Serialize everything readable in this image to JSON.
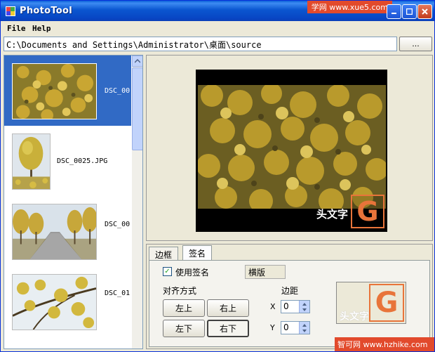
{
  "window": {
    "title": "PhotoTool"
  },
  "watermark_top": "学网 www.xue5.com",
  "watermark_bottom": "智可网 www.hzhike.com",
  "menu": {
    "file": "File",
    "help": "Help"
  },
  "path": {
    "value": "C:\\Documents and Settings\\Administrator\\桌面\\source",
    "browse_label": "..."
  },
  "thumbnails": [
    {
      "name": "DSC_00",
      "selected": true
    },
    {
      "name": "DSC_0025.JPG",
      "selected": false
    },
    {
      "name": "DSC_00",
      "selected": false
    },
    {
      "name": "DSC_01",
      "selected": false
    }
  ],
  "preview": {
    "watermark_text": "头文字",
    "logo_letter": "G"
  },
  "tabs": [
    {
      "label": "边框",
      "active": false
    },
    {
      "label": "签名",
      "active": true
    }
  ],
  "signature": {
    "use_signature_label": "使用签名",
    "use_signature_checked": true,
    "style_value": "横版",
    "alignment_label": "对齐方式",
    "align_buttons": [
      "左上",
      "右上",
      "左下",
      "右下"
    ],
    "align_selected": "右下",
    "margin_label": "边距",
    "x_label": "X",
    "x_value": "0",
    "y_label": "Y",
    "y_value": "0",
    "preview_text": "头文字",
    "preview_logo": "G"
  },
  "colors": {
    "accent": "#316ac5",
    "logo": "#e8743a",
    "titlebar": "#0a56d0"
  }
}
